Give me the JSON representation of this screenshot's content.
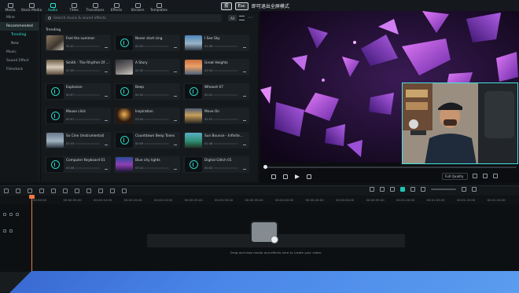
{
  "esc_hint": {
    "key1": "按",
    "key2": "Esc",
    "text": "即可退出全屏模式"
  },
  "toolbar": [
    {
      "label": "Media"
    },
    {
      "label": "Stock Media"
    },
    {
      "label": "Audio",
      "active": true
    },
    {
      "label": "Titles"
    },
    {
      "label": "Transitions"
    },
    {
      "label": "Effects"
    },
    {
      "label": "Stickers"
    },
    {
      "label": "Templates"
    }
  ],
  "sidebar": {
    "items": [
      {
        "label": "Mine"
      },
      {
        "label": "Recommended",
        "active": true
      },
      {
        "label": "Trending",
        "sub": true,
        "subactive": true
      },
      {
        "label": "New",
        "sub": true
      },
      {
        "label": "Music"
      },
      {
        "label": "Sound Effect"
      },
      {
        "label": "Filmstock"
      }
    ]
  },
  "library": {
    "search_placeholder": "Search music & sound effects",
    "all_label": "All",
    "section_title": "Trending",
    "cards": [
      {
        "title": "Feel the summer",
        "duration": "02:41",
        "thumb": "ph-a"
      },
      {
        "title": "Never start sing",
        "duration": "02:20",
        "thumb": "disc"
      },
      {
        "title": "I See Sky",
        "duration": "01:58",
        "thumb": "ph-c"
      },
      {
        "title": "Smith - The Rhythm Of ...",
        "duration": "02:09",
        "thumb": "ph-g"
      },
      {
        "title": "A Story",
        "duration": "02:32",
        "thumb": "ph-b"
      },
      {
        "title": "Great Heights",
        "duration": "02:34",
        "thumb": "ph-d"
      },
      {
        "title": "Explosion",
        "duration": "00:07",
        "thumb": "disc"
      },
      {
        "title": "Beep",
        "duration": "00:02",
        "thumb": "disc"
      },
      {
        "title": "Whoosh 07",
        "duration": "00:01",
        "thumb": "disc"
      },
      {
        "title": "Mouse click",
        "duration": "00:01",
        "thumb": "disc"
      },
      {
        "title": "Inspiration",
        "duration": "03:04",
        "thumb": "ph-e"
      },
      {
        "title": "Move On",
        "duration": "02:22",
        "thumb": "ph-f"
      },
      {
        "title": "So Cine (Instrumental)",
        "duration": "02:55",
        "thumb": "ph-j"
      },
      {
        "title": "Countdown Beep Tones",
        "duration": "00:09",
        "thumb": "disc"
      },
      {
        "title": "Sun Bounce - Infinite...",
        "duration": "02:48",
        "thumb": "ph-h"
      },
      {
        "title": "Computer Keyboard 01",
        "duration": "00:06",
        "thumb": "disc"
      },
      {
        "title": "Blue city lights",
        "duration": "03:10",
        "thumb": "ph-i"
      },
      {
        "title": "Digital Glitch 01",
        "duration": "00:02",
        "thumb": "disc"
      }
    ]
  },
  "preview": {
    "quality": "Full Quality"
  },
  "timeline": {
    "ticks": [
      "00:00:00",
      "00:00:05:00",
      "00:00:10:00",
      "00:00:15:00",
      "00:00:20:00",
      "00:00:25:00",
      "00:00:30:00",
      "00:00:35:00",
      "00:00:40:00",
      "00:00:45:00",
      "00:00:50:00",
      "00:00:55:00",
      "00:01:00:00",
      "00:01:05:00",
      "00:01:10:00",
      "00:01:15:00"
    ],
    "drop_text": "Drag and drop media and effects here to create your video."
  },
  "colors": {
    "accent": "#2ee6d2",
    "playhead": "#f07840",
    "webcam_border": "#43e3e0"
  }
}
